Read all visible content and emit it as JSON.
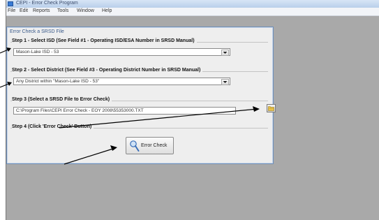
{
  "window": {
    "title": "CEPI - Error Check Program"
  },
  "menu": [
    "File",
    "Edit",
    "Reports",
    "Tools",
    "Window",
    "Help"
  ],
  "panel": {
    "title": "Error Check a SRSD File"
  },
  "step1": {
    "label": "Step 1 - Select ISD (See Field #1 - Operating ISD/ESA Number in SRSD Manual)",
    "value": "Mason-Lake ISD - 53"
  },
  "step2": {
    "label": "Step 2 - Select District (See Field #3 - Operating District Number in SRSD Manual)",
    "value": "Any District within \"Mason-Lake ISD - 53\""
  },
  "step3": {
    "label": "Step 3 (Select a SRSD File to Error Check)",
    "value": "C:\\Program Files\\CEPI Error Check - EOY 2008\\55353000.TXT"
  },
  "step4": {
    "label": "Step 4 (Click 'Error Check' Button)",
    "button_label": "Error Check"
  },
  "icons": {
    "app": "app-icon",
    "dropdown": "chevron-down-icon",
    "browse": "folder-icon",
    "error_check": "magnifier-icon"
  },
  "colors": {
    "workspace": "#a9a9a9",
    "panel": "#eeeeee",
    "panel_border": "#6f8fb8",
    "title_text": "#3a5a8a"
  }
}
